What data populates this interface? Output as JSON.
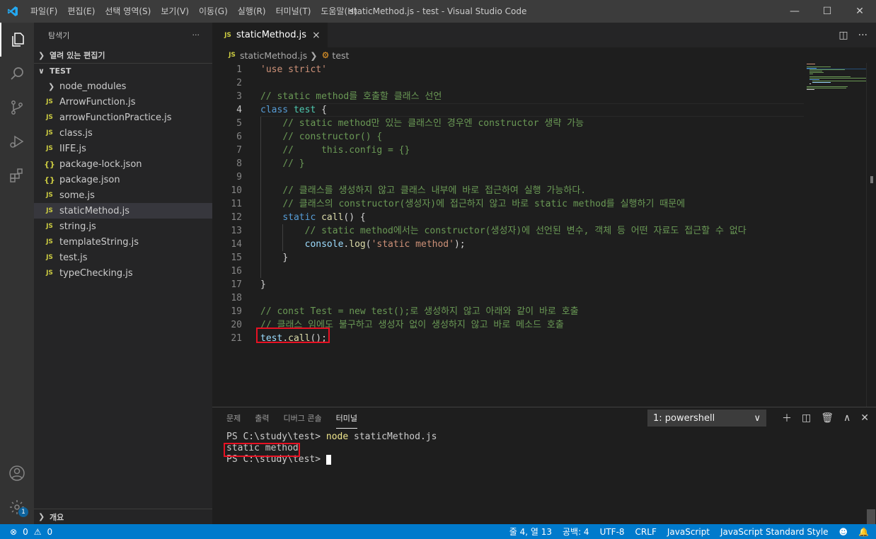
{
  "window": {
    "title": "staticMethod.js - test - Visual Studio Code",
    "menu": [
      "파일(F)",
      "편집(E)",
      "선택 영역(S)",
      "보기(V)",
      "이동(G)",
      "실행(R)",
      "터미널(T)",
      "도움말(H)"
    ]
  },
  "sidebar": {
    "title": "탐색기",
    "more": "···",
    "open_editors": "열려 있는 편집기",
    "folder": "TEST",
    "items": [
      {
        "name": "node_modules",
        "type": "folder"
      },
      {
        "name": "ArrowFunction.js",
        "type": "js"
      },
      {
        "name": "arrowFunctionPractice.js",
        "type": "js"
      },
      {
        "name": "class.js",
        "type": "js"
      },
      {
        "name": "IIFE.js",
        "type": "js"
      },
      {
        "name": "package-lock.json",
        "type": "json"
      },
      {
        "name": "package.json",
        "type": "json"
      },
      {
        "name": "some.js",
        "type": "js"
      },
      {
        "name": "staticMethod.js",
        "type": "js",
        "selected": true
      },
      {
        "name": "string.js",
        "type": "js"
      },
      {
        "name": "templateString.js",
        "type": "js"
      },
      {
        "name": "test.js",
        "type": "js"
      },
      {
        "name": "typeChecking.js",
        "type": "js"
      }
    ],
    "outline": "개요",
    "js_icon": "JS",
    "json_icon": "{}"
  },
  "editor": {
    "tab": "staticMethod.js",
    "tab_close": "×",
    "breadcrumb_file": "staticMethod.js",
    "breadcrumb_symbol": "test",
    "line_numbers": [
      "1",
      "2",
      "3",
      "4",
      "5",
      "6",
      "7",
      "8",
      "9",
      "10",
      "11",
      "12",
      "13",
      "14",
      "15",
      "16",
      "17",
      "18",
      "19",
      "20",
      "21"
    ],
    "code": {
      "l1": "'use strict'",
      "l3": "// static method를 호출할 클래스 선언",
      "l4_kw": "class",
      "l4_name": "test",
      "l4_brace": "{",
      "l5": "// static method만 있는 클래스인 경우엔 constructor 생략 가능",
      "l6": "// constructor() {",
      "l7": "//     this.config = {}",
      "l8": "// }",
      "l10": "// 클래스를 생성하지 않고 클래스 내부에 바로 접근하여 실행 가능하다.",
      "l11": "// 클래스의 constructor(생성자)에 접근하지 않고 바로 static method를 실행하기 때문에",
      "l12_kw": "static",
      "l12_fn": "call",
      "l12_rest": "() {",
      "l13": "// static method에서는 constructor(생성자)에 선언된 변수, 객체 등 어떤 자료도 접근할 수 없다",
      "l14_obj": "console",
      "l14_fn": "log",
      "l14_str": "'static method'",
      "l15": "}",
      "l17": "}",
      "l19": "// const Test = new test();로 생성하지 않고 아래와 같이 바로 호출",
      "l20": "// 클래스 임에도 불구하고 생성자 없이 생성하지 않고 바로 메소드 호출",
      "l21_obj": "test",
      "l21_fn": "call",
      "l21_rest": "();"
    }
  },
  "panel": {
    "tabs": [
      "문제",
      "출력",
      "디버그 콘솔",
      "터미널"
    ],
    "active_tab": "터미널",
    "terminal_select": "1: powershell",
    "terminal": {
      "prompt": "PS C:\\study\\test> ",
      "command": "node",
      "args": " staticMethod.js",
      "output": "static method",
      "prompt2": "PS C:\\study\\test> "
    }
  },
  "statusbar": {
    "errors": "0",
    "warnings": "0",
    "position": "줄 4, 열 13",
    "spaces": "공백: 4",
    "encoding": "UTF-8",
    "eol": "CRLF",
    "language": "JavaScript",
    "linter": "JavaScript Standard Style"
  },
  "colors": {
    "accent": "#007acc",
    "highlight_box": "#e81123"
  }
}
